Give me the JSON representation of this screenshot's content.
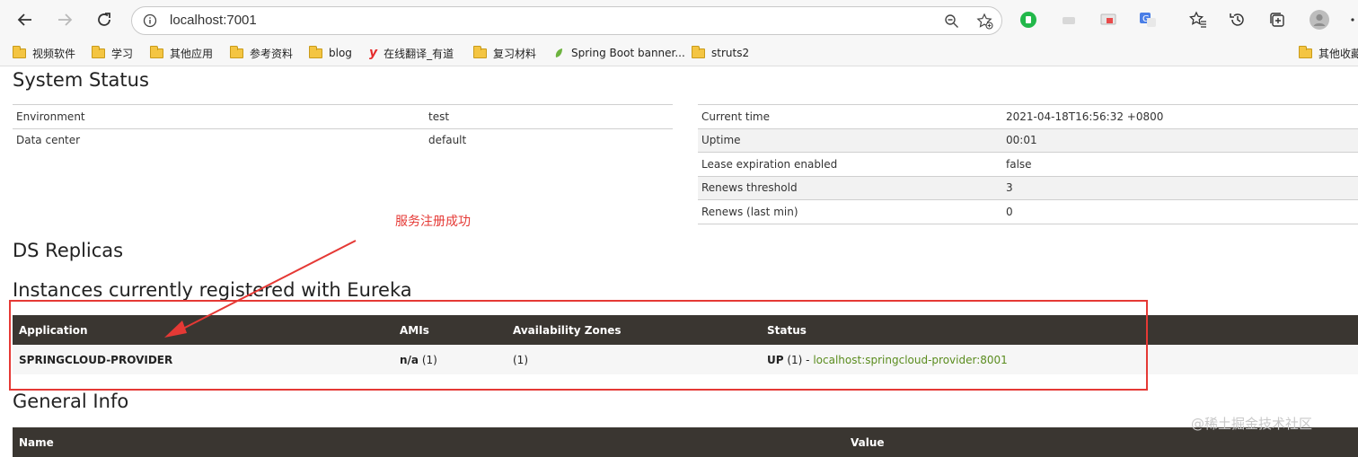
{
  "browser": {
    "url": "localhost:7001",
    "bookmarks": [
      {
        "label": "视频软件",
        "icon": "folder-icon"
      },
      {
        "label": "学习",
        "icon": "folder-icon"
      },
      {
        "label": "其他应用",
        "icon": "folder-icon"
      },
      {
        "label": "参考资料",
        "icon": "folder-icon"
      },
      {
        "label": "blog",
        "icon": "folder-icon"
      },
      {
        "label": "在线翻译_有道",
        "icon": "youdao-icon"
      },
      {
        "label": "复习材料",
        "icon": "folder-icon"
      },
      {
        "label": "Spring Boot banner...",
        "icon": "spring-leaf-icon"
      },
      {
        "label": "struts2",
        "icon": "folder-icon"
      }
    ],
    "other_bookmarks": "其他收藏"
  },
  "system_status": {
    "title": "System Status",
    "left": [
      {
        "key": "Environment",
        "value": "test"
      },
      {
        "key": "Data center",
        "value": "default"
      }
    ],
    "right": [
      {
        "key": "Current time",
        "value": "2021-04-18T16:56:32 +0800"
      },
      {
        "key": "Uptime",
        "value": "00:01"
      },
      {
        "key": "Lease expiration enabled",
        "value": "false"
      },
      {
        "key": "Renews threshold",
        "value": "3"
      },
      {
        "key": "Renews (last min)",
        "value": "0"
      }
    ]
  },
  "ds_replicas": {
    "title": "DS Replicas"
  },
  "instances": {
    "title": "Instances currently registered with Eureka",
    "headers": {
      "application": "Application",
      "amis": "AMIs",
      "zones": "Availability Zones",
      "status": "Status"
    },
    "rows": [
      {
        "application": "SPRINGCLOUD-PROVIDER",
        "amis_bold": "n/a",
        "amis_count": " (1)",
        "zones": "(1)",
        "status_bold": "UP",
        "status_rest": " (1) - ",
        "status_link": "localhost:springcloud-provider:8001"
      }
    ]
  },
  "general_info": {
    "title": "General Info",
    "headers": {
      "name": "Name",
      "value": "Value"
    }
  },
  "annotation": {
    "text": "服务注册成功",
    "color": "#e53935"
  },
  "watermark": "@稀土掘金技术社区"
}
